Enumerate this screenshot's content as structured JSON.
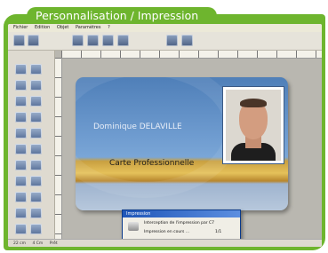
{
  "header": {
    "title": "Personnalisation / Impression"
  },
  "app": {
    "menu": [
      "Fichier",
      "Edition",
      "Objet",
      "Paramètres",
      "?"
    ],
    "status": [
      "22 cm",
      "4 Cm",
      "Prêt"
    ]
  },
  "card": {
    "name": "Dominique DELAVILLE",
    "role": "Carte Professionnelle"
  },
  "print_dialog": {
    "title": "Impression",
    "line1": "Interception de l'impression par C7",
    "line2": "Impression en cours ...",
    "count": "1/1"
  },
  "colors": {
    "frame": "#6eb52e",
    "card_blue": "#4f7fb8",
    "card_gold": "#e5c15a",
    "dialog_title": "#1f56b8"
  },
  "icons": [
    "printer-icon",
    "toolbar-tool-icon"
  ]
}
